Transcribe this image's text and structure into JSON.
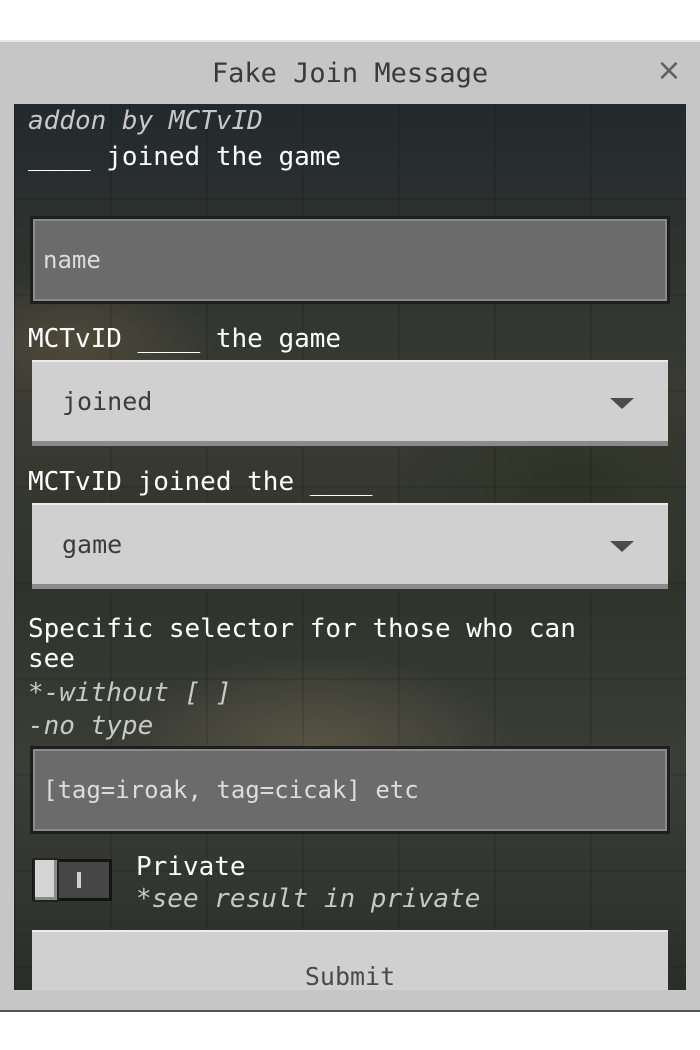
{
  "dialog": {
    "title": "Fake Join Message",
    "close_glyph": "×"
  },
  "addon_credit": "addon by MCTvID",
  "name_field": {
    "label": "____ joined the game",
    "placeholder": "name",
    "value": ""
  },
  "action_dropdown": {
    "label": "MCTvID ____ the game",
    "selected": "joined"
  },
  "target_dropdown": {
    "label": "MCTvID joined the ____",
    "selected": "game"
  },
  "selector_field": {
    "label_line1": "Specific selector for those who can",
    "label_line2": "see",
    "note1": "*-without [ ]",
    "note2": " -no type",
    "placeholder": "[tag=iroak, tag=cicak] etc",
    "value": ""
  },
  "private_toggle": {
    "label": "Private",
    "note": "*see result in private",
    "state": "off"
  },
  "submit_label": "Submit"
}
